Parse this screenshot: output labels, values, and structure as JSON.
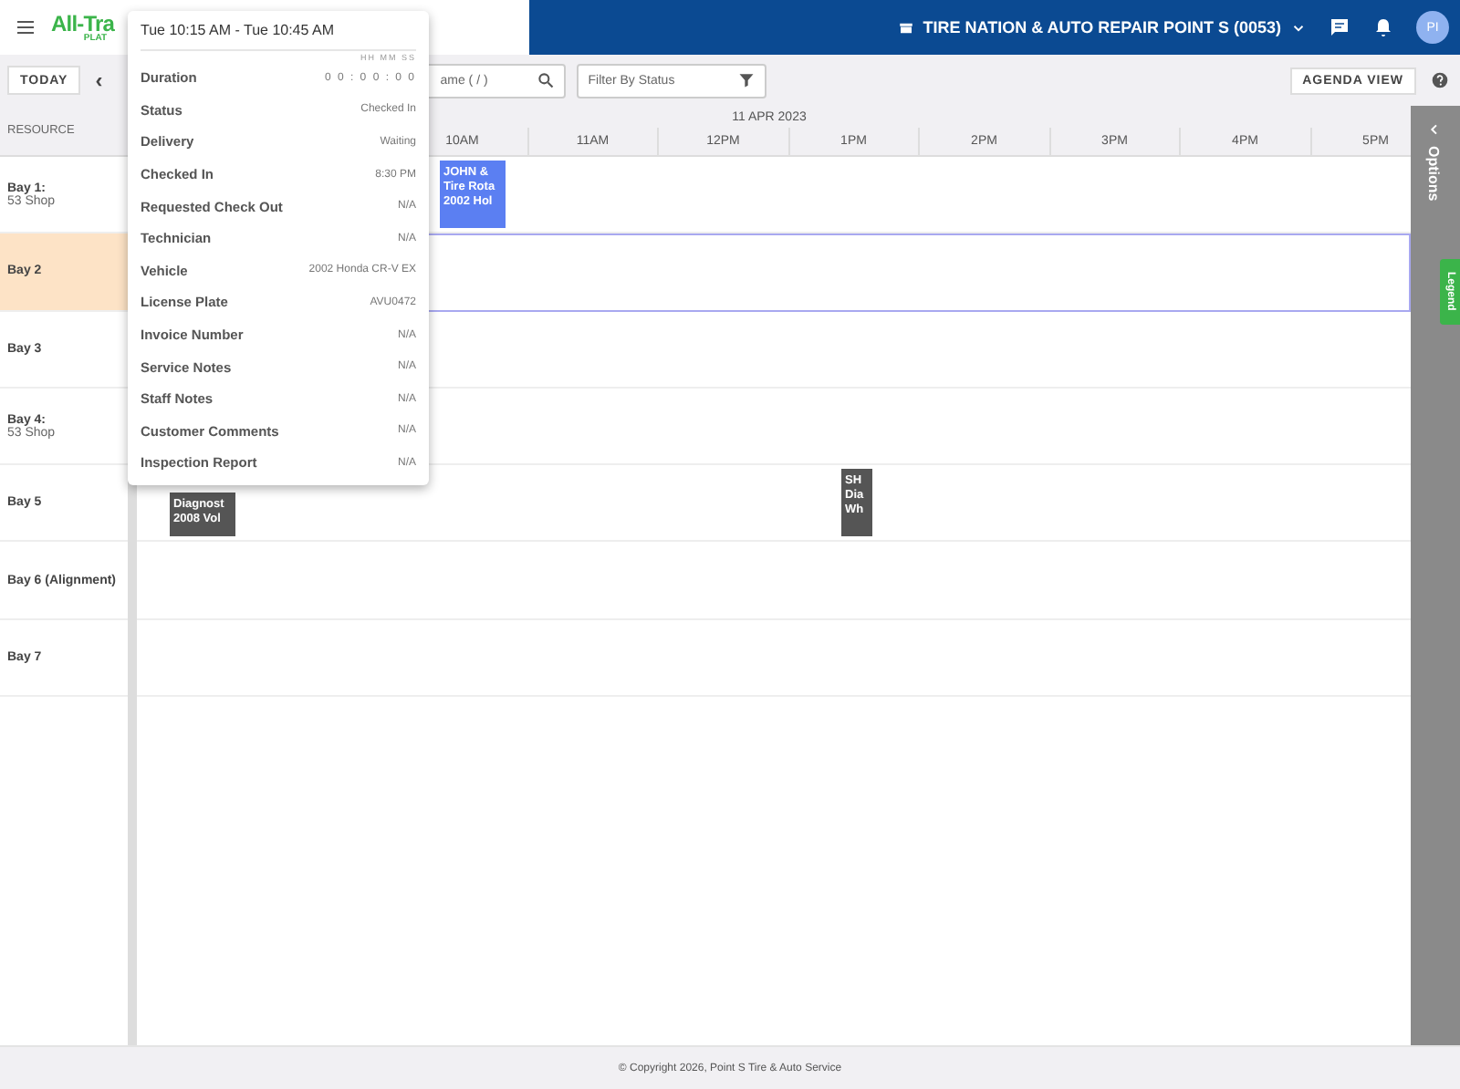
{
  "header": {
    "logo": "All-Tra",
    "logo_sub": "PLAT",
    "shop": "TIRE NATION & AUTO REPAIR POINT S (0053)",
    "avatar": "PI"
  },
  "toolbar": {
    "today": "TODAY",
    "prev": "‹",
    "search": {
      "placeholder": "ame ( / )"
    },
    "filter": {
      "placeholder": "Filter By Status"
    },
    "agenda": "AGENDA VIEW"
  },
  "schedule": {
    "resource_heading": "RESOURCE",
    "date": "11 APR 2023",
    "hours": [
      "10AM",
      "11AM",
      "12PM",
      "1PM",
      "2PM",
      "3PM",
      "4PM",
      "5PM"
    ],
    "resources": [
      {
        "name": "Bay 1:",
        "sub": "53 Shop",
        "selected": false,
        "events": [
          {
            "lines": [
              "JOHN &",
              "Tire Rota",
              "2002 Hol"
            ],
            "color": "#5b7ff2"
          }
        ]
      },
      {
        "name": "Bay 2",
        "selected": true
      },
      {
        "name": "Bay 3",
        "selected": false
      },
      {
        "name": "Bay 4:",
        "sub": "53 Shop",
        "selected": false
      },
      {
        "name": "Bay 5",
        "selected": false,
        "events": [
          {
            "lines": [
              "Diagnost",
              "2008 Vol"
            ],
            "color": "#555555"
          },
          {
            "lines": [
              "SH",
              "Dia",
              "Wh"
            ],
            "color": "#555555"
          }
        ]
      },
      {
        "name": "Bay 6 (Alignment)",
        "selected": false
      },
      {
        "name": "Bay 7",
        "selected": false
      }
    ]
  },
  "options_panel": {
    "title": "Options",
    "tab": "Legend"
  },
  "popup": {
    "title": "Tue 10:15 AM - Tue 10:45 AM",
    "duration_hint": "HH MM SS",
    "rows": [
      {
        "label": "Duration",
        "value": "0 0 : 0 0 : 0 0"
      },
      {
        "label": "Status",
        "value": "Checked In"
      },
      {
        "label": "Delivery",
        "value": "Waiting"
      },
      {
        "label": "Checked In",
        "value": "8:30 PM"
      },
      {
        "label": "Requested Check Out",
        "value": "N/A"
      },
      {
        "label": "Technician",
        "value": "N/A"
      },
      {
        "label": "Vehicle",
        "value": "2002 Honda CR-V EX"
      },
      {
        "label": "License Plate",
        "value": "AVU0472"
      },
      {
        "label": "Invoice Number",
        "value": "N/A"
      },
      {
        "label": "Service Notes",
        "value": "N/A"
      },
      {
        "label": "Staff Notes",
        "value": "N/A"
      },
      {
        "label": "Customer Comments",
        "value": "N/A"
      },
      {
        "label": "Inspection Report",
        "value": "N/A"
      }
    ]
  },
  "footer": "© Copyright 2026, Point S Tire & Auto Service"
}
